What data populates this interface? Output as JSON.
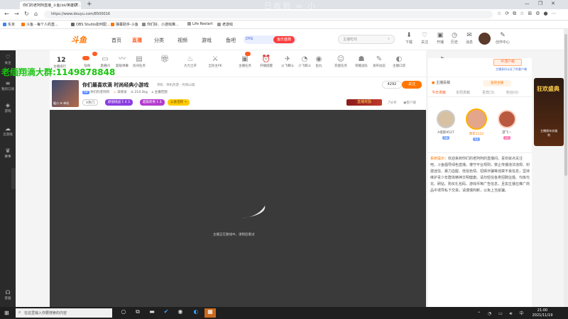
{
  "browser": {
    "tab_title": "你们的老阿阿直播_斗鱼(lol/英雄联...",
    "url": "https://www.douyu.com/8500016",
    "bookmarks": [
      "东京",
      "斗鱼 - 每个人的直...",
      "OBS Studio如何配...",
      "弹幕助手-斗鱼",
      "你们好、小游戏推...",
      "Life Restart",
      "老游戏"
    ],
    "overlay_watermark": "已收到 ∞ 小"
  },
  "site": {
    "logo": "斗鱼",
    "nav": [
      "首页",
      "直播",
      "分类",
      "视频",
      "游戏",
      "鱼吧"
    ],
    "nav_active": "直播",
    "badge_left": "DYG",
    "badge_right": "鱼乐盛典",
    "search_placeholder": "主播吃鸡",
    "header_icons": [
      "下载",
      "关注",
      "开播",
      "历史",
      "消息",
      "创作中心"
    ]
  },
  "sidebar": {
    "items": [
      "关注",
      "我的订阅",
      "游戏",
      "云游戏",
      "赛事",
      "客服"
    ]
  },
  "giftbar": {
    "count": "12",
    "count_label": "主播排行",
    "items": [
      "钻粉",
      "直播间",
      "超级弹幕",
      "房间任务",
      "",
      "大力士开",
      "全民主PK",
      "主播任务",
      "开播提醒",
      "火飞棘斗",
      "小飞鲸斗",
      "鱼丸",
      "充能任务",
      "荣耀战队",
      "发布动态",
      "主播口袋",
      "视频封面",
      "更多"
    ]
  },
  "watermark_qq": "老缅翔滴大群:1149878848",
  "streamer": {
    "title": "你们最喜欢滴 时尚经典小游戏",
    "category": "单机",
    "sub_category": "单机热游 · 丹阳山城",
    "name": "你们的老阿阿",
    "level": "68",
    "fans_label": "日榜贡",
    "weight": "214.3kg",
    "district": "主播范围",
    "tags": [
      "V热门",
      "颜值挑战 1 4 3",
      "超级新秀 1 4",
      "公会活跃 +"
    ],
    "cover_label": "暖爪 ⑨ 单机",
    "follower_count": "4292",
    "follow_label": "关注",
    "banner": "直播奖励",
    "share": "分享",
    "report": "客户端"
  },
  "player": {
    "message": "主播正在路线中，请稍后重试"
  },
  "right_panel": {
    "pc_button": "PC客户端",
    "pc_sub": "主播身份认证了的客户端",
    "group_label": "主播投稿",
    "group2": "鱼吧主播",
    "tabs": [
      "今日贡献",
      "本周贡献",
      "贵宾(3)",
      "粉丝(0)"
    ],
    "active_tab": "今日贡献",
    "ranks": [
      {
        "name": "A夜影9527",
        "level": "18"
      },
      {
        "name": "周年1112",
        "level": "12"
      },
      {
        "name": "游飞ヽ",
        "level": "15"
      }
    ],
    "system_label": "系统提示",
    "system_msg": "欢迎来到你们的老阿阿的直播间。喜欢就点关注吧。斗鱼倡导绿色直播，遵守平台规则，禁止传播违法违规、封建迷信、暴力血腥、低俗色情、招嫖诈骗等违禁不良信息，坚持维护青少年群体精神文明健康。请勿轻信各类招聘征婚、代练代充、刷钻、购买礼包码、游戏币等广告信息，且如主播在推广商品中诱导私下交易，请谨慎判断，以免上当受骗。",
    "promo_title": "狂欢盛典",
    "promo_sub": "主播周年庆福利"
  },
  "taskbar": {
    "search_placeholder": "在这里输入你要搜索的内容",
    "time": "21:00",
    "date": "2021/11/19",
    "lang": "中"
  }
}
